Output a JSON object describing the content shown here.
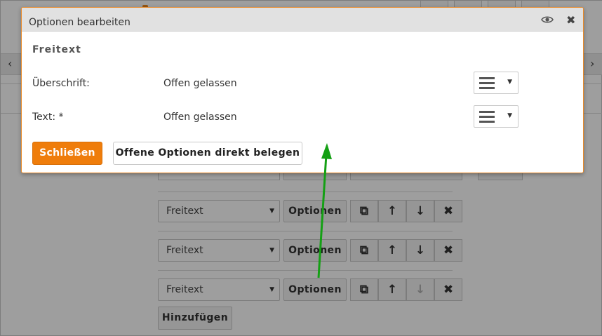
{
  "dialog": {
    "title": "Optionen bearbeiten",
    "subtitle": "Freitext",
    "fields": [
      {
        "label": "Überschrift:",
        "value": "Offen gelassen"
      },
      {
        "label": "Text: *",
        "value": "Offen gelassen"
      }
    ],
    "close_button": "Schließen",
    "direct_button": "Offene Optionen direkt belegen"
  },
  "background": {
    "rows": [
      {
        "select_value": "Freitext",
        "options_label": "Optionen",
        "down_disabled": false
      },
      {
        "select_value": "Freitext",
        "options_label": "Optionen",
        "down_disabled": false
      },
      {
        "select_value": "Freitext",
        "options_label": "Optionen",
        "down_disabled": true
      }
    ],
    "add_button": "Hinzufügen"
  },
  "colors": {
    "accent_orange": "#ef7d0b",
    "annotation_arrow": "#14a014",
    "dialog_border": "#e88a2a"
  },
  "icons": {
    "eye": "eye-icon",
    "close": "close-icon",
    "menu": "hamburger-menu-icon",
    "copy": "copy-icon",
    "up": "arrow-up-icon",
    "down": "arrow-down-icon",
    "delete": "delete-x-icon"
  }
}
